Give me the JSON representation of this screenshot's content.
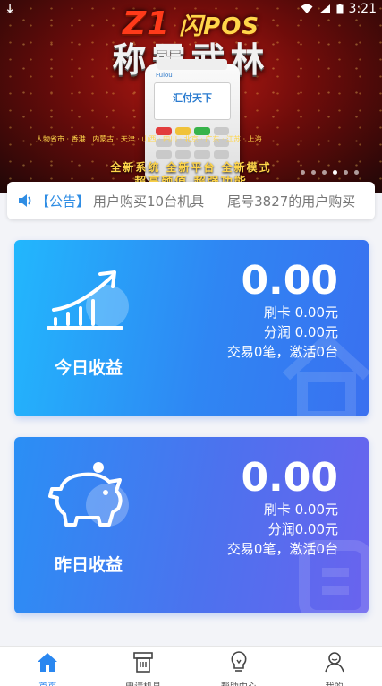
{
  "status_bar": {
    "time": "3:21"
  },
  "banner": {
    "headline_model": "Z1",
    "headline_top": "闪POS",
    "headline_main": "称霸武林",
    "device_brand": "Fuiou",
    "device_logo": "汇付天下",
    "tag_line": "人物省市 · 香港 · 内蒙古 · 天津 · 山西 · 四川 · 北京 · 广东 · 江苏 · 上海",
    "slogan_1": "全新系统  全新平台  全新模式",
    "slogan_2": "超高颜值  超强功能",
    "dot_count": 6,
    "active_dot": 3
  },
  "notice": {
    "label": "【公告】",
    "messages": [
      "用户购买10台机具",
      "尾号3827的用户购买"
    ]
  },
  "today": {
    "title": "今日收益",
    "amount": "0.00",
    "card_swipe": "刷卡 0.00元",
    "profit_share": "分润 0.00元",
    "summary": "交易0笔，激活0台"
  },
  "yesterday": {
    "title": "昨日收益",
    "amount": "0.00",
    "card_swipe": "刷卡 0.00元",
    "profit_share": "分润0.00元",
    "summary": "交易0笔，激活0台"
  },
  "nav": {
    "items": [
      {
        "label": "首页",
        "icon": "home-icon",
        "active": true
      },
      {
        "label": "申请机具",
        "icon": "pos-terminal-icon",
        "active": false
      },
      {
        "label": "帮助中心",
        "icon": "lightbulb-icon",
        "active": false
      },
      {
        "label": "我的",
        "icon": "user-icon",
        "active": false
      }
    ]
  },
  "colors": {
    "accent": "#2a87f0",
    "notice_label": "#2f8de4",
    "today_gradient_start": "#22b7fd",
    "yesterday_gradient_end": "#6a63ee"
  }
}
